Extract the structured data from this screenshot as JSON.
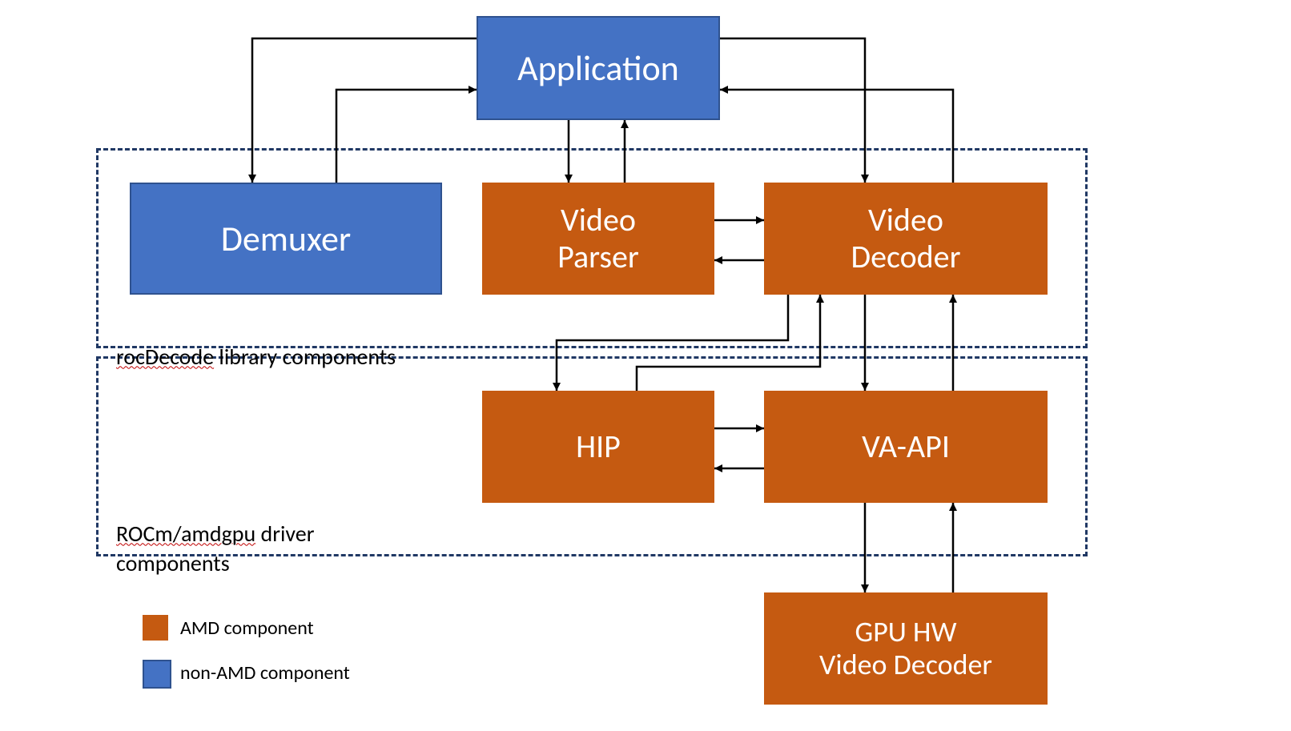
{
  "nodes": {
    "application": "Application",
    "demuxer": "Demuxer",
    "videoParser": "Video\nParser",
    "videoDecoder": "Video\nDecoder",
    "hip": "HIP",
    "vaapi": "VA-API",
    "gpuHw": "GPU HW\nVideo Decoder"
  },
  "groups": {
    "library": {
      "name": "rocDecode",
      "suffix": " library components"
    },
    "driver": {
      "name": "ROCm/amdgpu",
      "suffix": " driver\ncomponents"
    }
  },
  "legend": {
    "amd": "AMD component",
    "nonAmd": "non-AMD component"
  },
  "colors": {
    "blue": "#4472c4",
    "blueBorder": "#2f528f",
    "orange": "#c55a11",
    "dash": "#203864"
  },
  "chart_data": {
    "type": "diagram",
    "title": "rocDecode architecture",
    "nodes": [
      {
        "id": "application",
        "label": "Application",
        "category": "non-AMD"
      },
      {
        "id": "demuxer",
        "label": "Demuxer",
        "category": "non-AMD",
        "group": "rocDecode library components"
      },
      {
        "id": "videoParser",
        "label": "Video Parser",
        "category": "AMD",
        "group": "rocDecode library components"
      },
      {
        "id": "videoDecoder",
        "label": "Video Decoder",
        "category": "AMD",
        "group": "rocDecode library components"
      },
      {
        "id": "hip",
        "label": "HIP",
        "category": "AMD",
        "group": "ROCm/amdgpu driver components"
      },
      {
        "id": "vaapi",
        "label": "VA-API",
        "category": "AMD",
        "group": "ROCm/amdgpu driver components"
      },
      {
        "id": "gpuHw",
        "label": "GPU HW Video Decoder",
        "category": "AMD"
      }
    ],
    "groups": [
      "rocDecode library components",
      "ROCm/amdgpu driver components"
    ],
    "legend": {
      "AMD": "AMD component",
      "non-AMD": "non-AMD component"
    },
    "edges": [
      {
        "from": "application",
        "to": "demuxer",
        "bidirectional": true
      },
      {
        "from": "application",
        "to": "videoParser",
        "bidirectional": true
      },
      {
        "from": "application",
        "to": "videoDecoder",
        "bidirectional": true
      },
      {
        "from": "videoParser",
        "to": "videoDecoder",
        "bidirectional": true
      },
      {
        "from": "videoDecoder",
        "to": "hip",
        "bidirectional": true
      },
      {
        "from": "videoDecoder",
        "to": "vaapi",
        "bidirectional": true
      },
      {
        "from": "hip",
        "to": "vaapi",
        "bidirectional": true
      },
      {
        "from": "vaapi",
        "to": "gpuHw",
        "bidirectional": true
      }
    ]
  }
}
